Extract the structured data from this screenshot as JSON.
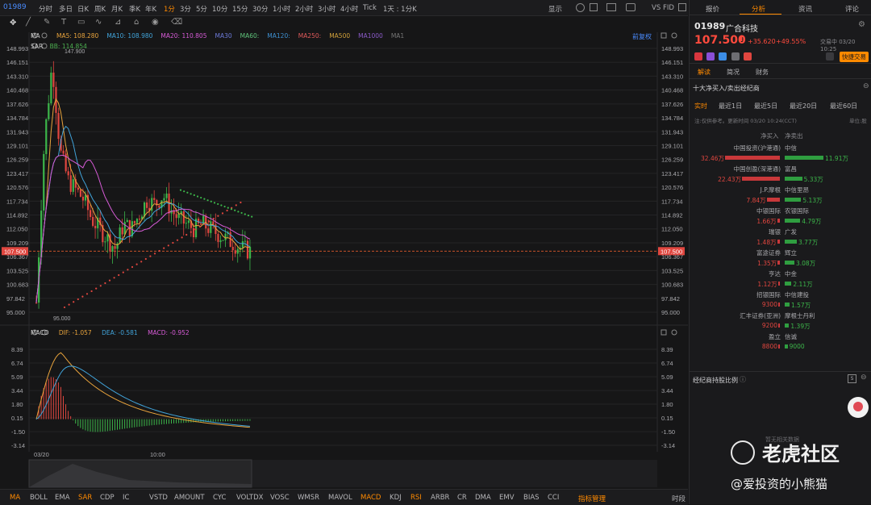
{
  "topbar": {
    "symbol": "01989",
    "timeframes": [
      "分时",
      "多日",
      "日K",
      "周K",
      "月K",
      "季K",
      "年K",
      "1分",
      "3分",
      "5分",
      "10分",
      "15分",
      "30分",
      "1小时",
      "2小时",
      "3小时",
      "4小时",
      "Tick",
      "1天 : 1分K"
    ],
    "active_timeframe": "1分",
    "display_label": "显示",
    "vs_label": "VS",
    "fid_label": "FID"
  },
  "ma_legend": {
    "label": "MA",
    "items": [
      {
        "label": "MA5: 108.280",
        "color": "#e8a33c"
      },
      {
        "label": "MA10: 108.980",
        "color": "#41a3d9"
      },
      {
        "label": "MA20: 110.805",
        "color": "#d65bd6"
      },
      {
        "label": "MA30",
        "color": "#6c7ad8"
      },
      {
        "label": "MA60:",
        "color": "#5fc37a"
      },
      {
        "label": "MA120:",
        "color": "#3e8fcf"
      },
      {
        "label": "MA250:",
        "color": "#e05a5a"
      },
      {
        "label": "MA500",
        "color": "#d0a03a"
      },
      {
        "label": "MA1000",
        "color": "#8a5ac8"
      },
      {
        "label": "MA1",
        "color": "#777777"
      }
    ],
    "adjust_label": "前复权"
  },
  "sar_legend": {
    "label": "SAR",
    "value": "BB: 114.854",
    "color": "#4caf50"
  },
  "price_axis": {
    "ticks": [
      "148.993",
      "146.151",
      "143.310",
      "140.468",
      "137.626",
      "134.784",
      "131.943",
      "129.101",
      "126.259",
      "123.417",
      "120.576",
      "117.734",
      "114.892",
      "112.050",
      "109.209",
      "106.367",
      "103.525",
      "100.683",
      "97.842",
      "95.000"
    ]
  },
  "price_labels": {
    "current": "107.500",
    "high": "147.900",
    "low": "95.000"
  },
  "macd_legend": {
    "label": "MACD",
    "dif": "DIF: -1.057",
    "dea": "DEA: -0.581",
    "macd": "MACD: -0.952",
    "dif_color": "#e8a33c",
    "dea_color": "#41a3d9",
    "macd_color": "#d65bd6"
  },
  "macd_axis": {
    "ticks": [
      "8.39",
      "6.74",
      "5.09",
      "3.44",
      "1.80",
      "0.15",
      "-1.50",
      "-3.14"
    ]
  },
  "time_axis": {
    "labels": [
      "03/20",
      "10:00"
    ]
  },
  "bottom_tabs": [
    "MA",
    "BOLL",
    "EMA",
    "SAR",
    "CDP",
    "IC",
    "VSTD",
    "AMOUNT",
    "CYC",
    "VOLTDX",
    "VOSC",
    "WMSR",
    "MAVOL",
    "MACD",
    "KDJ",
    "RSI",
    "ARBR",
    "CR",
    "DMA",
    "EMV",
    "BIAS",
    "CCI",
    "指标管理",
    "时段"
  ],
  "bottom_tabs_active": [
    "MA",
    "SAR",
    "MACD",
    "RSI",
    "指标管理"
  ],
  "panel": {
    "tabs": [
      "报价",
      "分析",
      "资讯",
      "评论"
    ],
    "active_tab": "分析",
    "code": "01989",
    "name": "广合科技",
    "price": "107.500",
    "change": "+35.620",
    "change_pct": "+49.55%",
    "trade_time": "交易中 03/20 10:25",
    "quick_trade": "快捷交易",
    "subtabs": [
      "解读",
      "简况",
      "财务"
    ],
    "active_subtab": "解读",
    "section_title": "十大净买入/卖出经纪商",
    "ranges": [
      "实时",
      "最近1日",
      "最近5日",
      "最近20日",
      "最近60日"
    ],
    "active_range": "实时",
    "note": "注:仅供参考。更新时间 03/20 10:24(CCT)",
    "unit": "单位:股",
    "col_buy": "净买入",
    "col_sell": "净卖出",
    "brokers": [
      {
        "left": "中国投资(沪港通)",
        "left_val": "32.46万",
        "left_pct": 1.0,
        "right": "中信",
        "right_val": "11.91万",
        "right_pct": 0.8
      },
      {
        "left": "中国创盈(深港通)",
        "left_val": "22.43万",
        "left_pct": 0.69,
        "right": "富昌",
        "right_val": "5.33万",
        "right_pct": 0.36
      },
      {
        "left": "J.P.摩根",
        "left_val": "7.84万",
        "left_pct": 0.24,
        "right": "中信里昂",
        "right_val": "5.13万",
        "right_pct": 0.34
      },
      {
        "left": "中银国际",
        "left_val": "1.66万",
        "left_pct": 0.05,
        "right": "农银国际",
        "right_val": "4.79万",
        "right_pct": 0.32
      },
      {
        "left": "瑞银",
        "left_val": "1.48万",
        "left_pct": 0.05,
        "right": "广发",
        "right_val": "3.77万",
        "right_pct": 0.25
      },
      {
        "left": "富途证券",
        "left_val": "1.35万",
        "left_pct": 0.04,
        "right": "辉立",
        "right_val": "3.08万",
        "right_pct": 0.2
      },
      {
        "left": "亨达",
        "left_val": "1.12万",
        "left_pct": 0.035,
        "right": "中金",
        "right_val": "2.11万",
        "right_pct": 0.14
      },
      {
        "left": "招银国际",
        "left_val": "9300",
        "left_pct": 0.03,
        "right": "中信建投",
        "right_val": "1.57万",
        "right_pct": 0.1
      },
      {
        "left": "汇丰证券(亚洲)",
        "left_val": "9200",
        "left_pct": 0.03,
        "right": "摩根士丹利",
        "right_val": "1.39万",
        "right_pct": 0.09
      },
      {
        "left": "盈立",
        "left_val": "8800",
        "left_pct": 0.027,
        "right": "信诚",
        "right_val": "9000",
        "right_pct": 0.06
      }
    ],
    "holding_title": "经纪商持股比例",
    "no_data": "暂无相关数据",
    "watermark": "老虎社区",
    "watermark_sub": "@爱投资的小熊猫"
  }
}
